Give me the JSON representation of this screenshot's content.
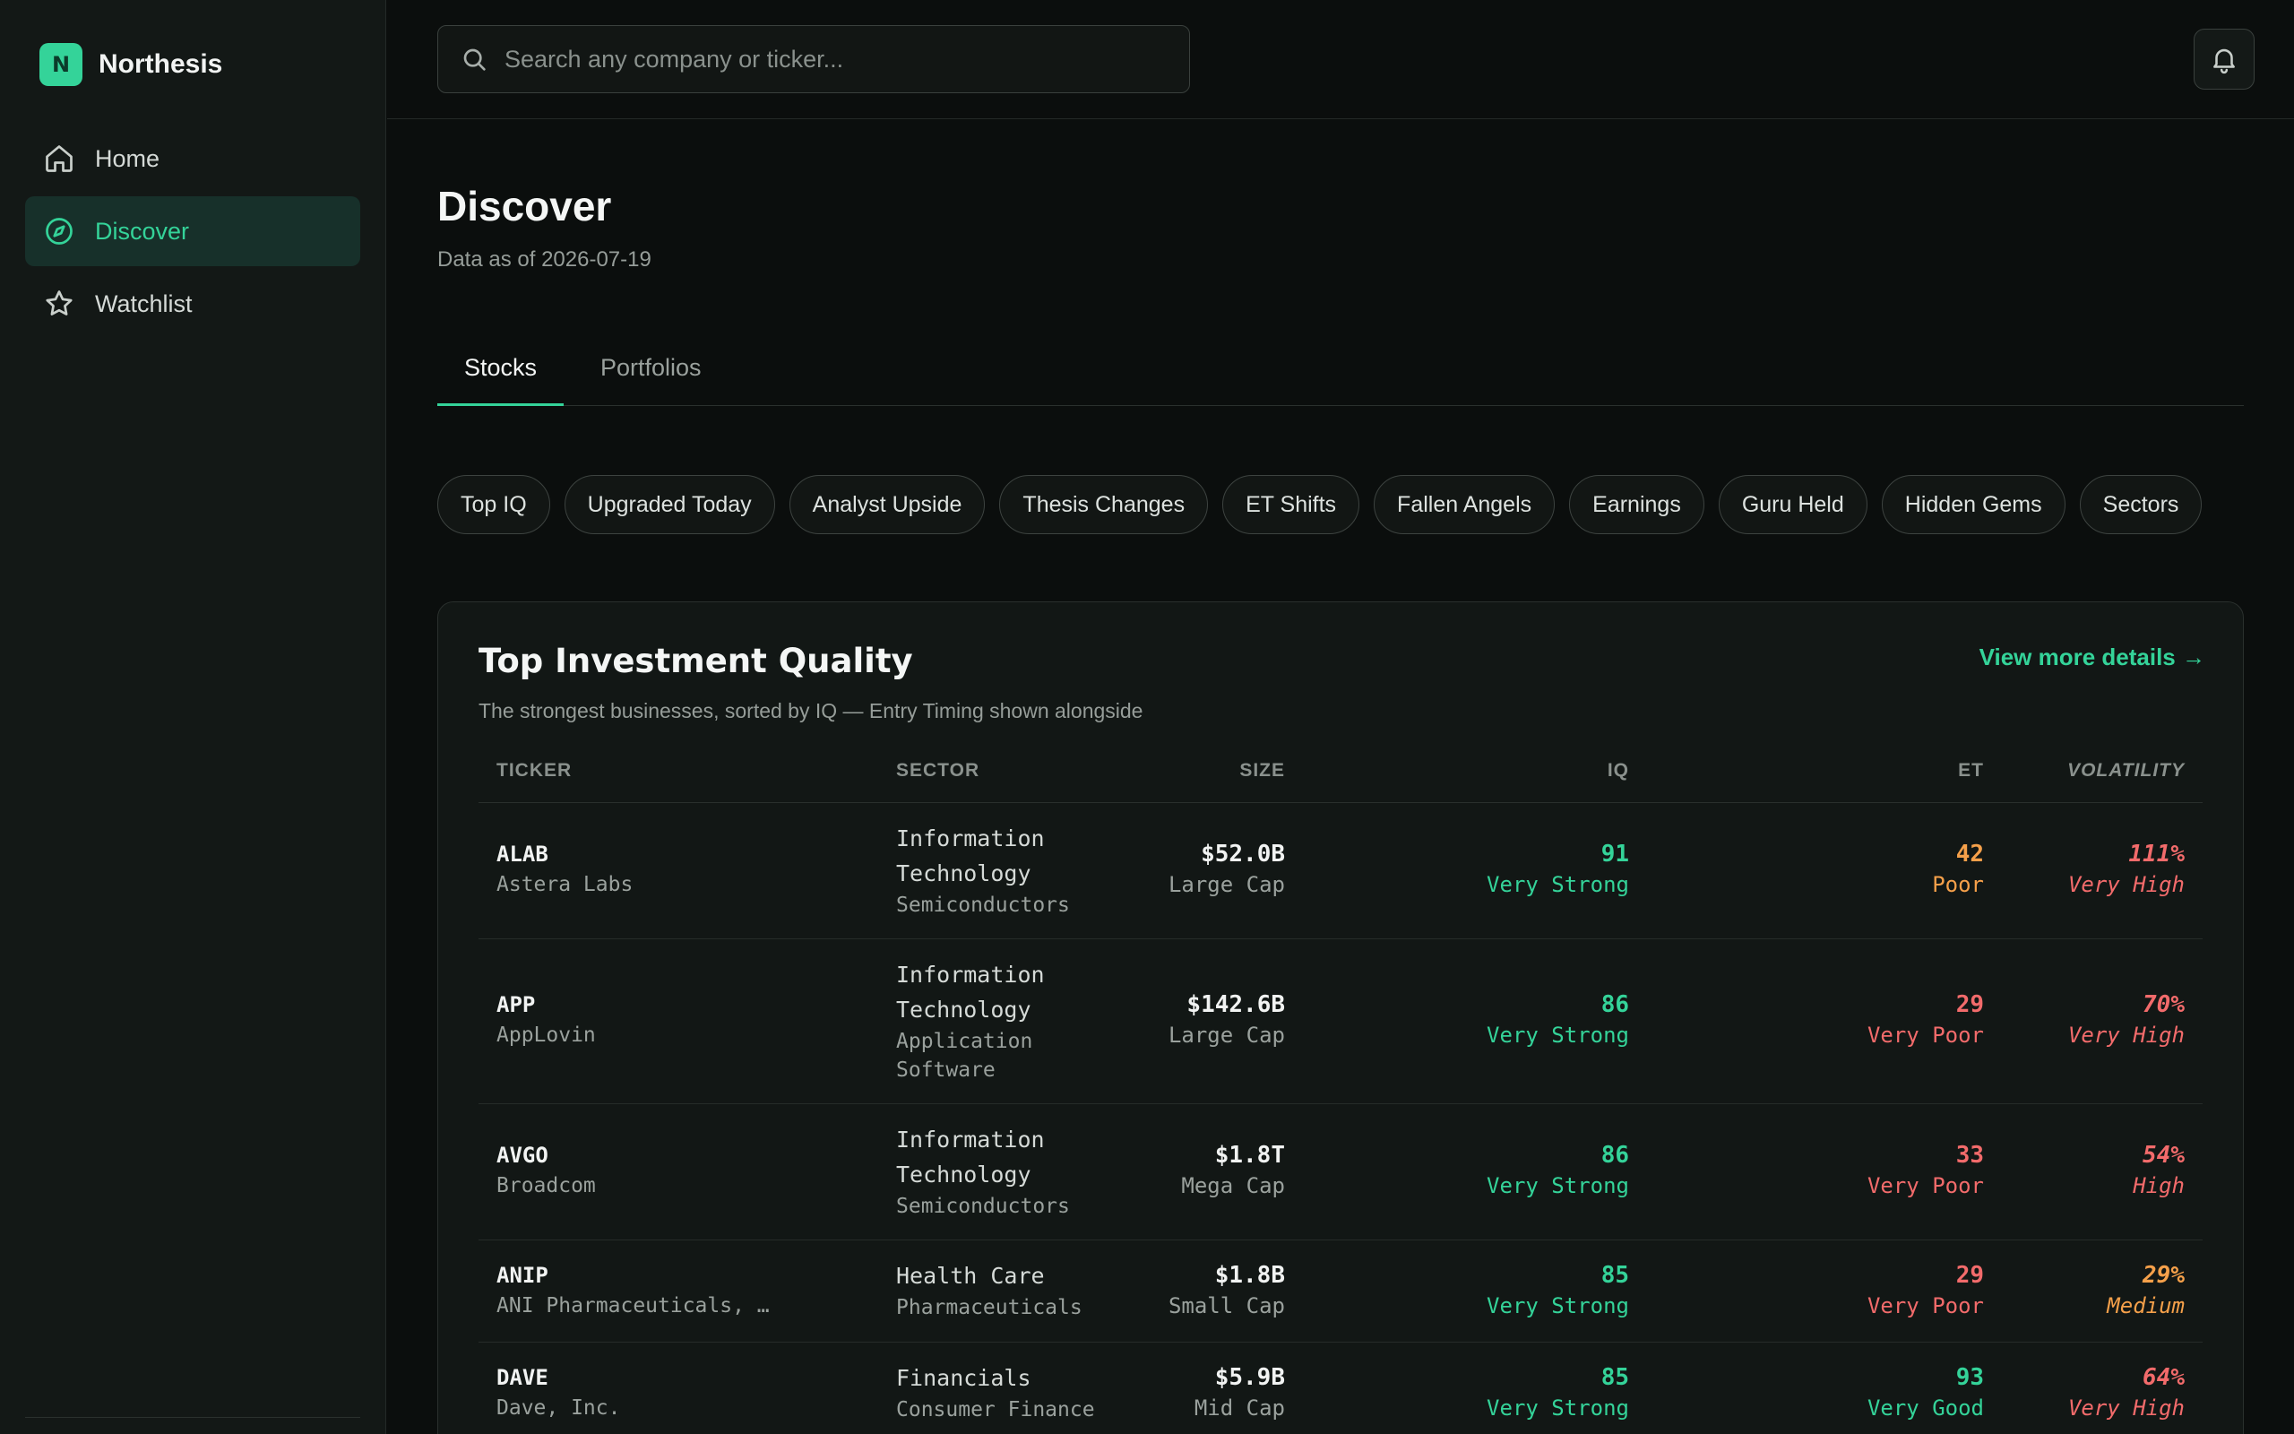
{
  "brand": {
    "logo_letter": "N",
    "name": "Northesis"
  },
  "nav": {
    "items": [
      {
        "label": "Home",
        "icon": "home-icon"
      },
      {
        "label": "Discover",
        "icon": "compass-icon",
        "active": true
      },
      {
        "label": "Watchlist",
        "icon": "star-icon"
      }
    ]
  },
  "search": {
    "placeholder": "Search any company or ticker..."
  },
  "page": {
    "title": "Discover",
    "subtitle": "Data as of 2026-07-19"
  },
  "tabs": [
    {
      "label": "Stocks",
      "active": true
    },
    {
      "label": "Portfolios"
    }
  ],
  "chips": [
    "Top IQ",
    "Upgraded Today",
    "Analyst Upside",
    "Thesis Changes",
    "ET Shifts",
    "Fallen Angels",
    "Earnings",
    "Guru Held",
    "Hidden Gems",
    "Sectors"
  ],
  "card": {
    "title": "Top Investment Quality",
    "link": "View more details →",
    "description": "The strongest businesses, sorted by IQ — Entry Timing shown alongside"
  },
  "table": {
    "headers": {
      "ticker": "TICKER",
      "sector": "SECTOR",
      "size": "SIZE",
      "iq": "IQ",
      "et": "ET",
      "volatility": "VOLATILITY"
    },
    "rows": [
      {
        "ticker": "ALAB",
        "company": "Astera Labs",
        "sector_line1": "Information",
        "sector_line2": "Technology",
        "industry_line1": "Semiconductors",
        "industry_line2": "",
        "size": "$52.0B",
        "cap": "Large Cap",
        "iq": "91",
        "iq_label": "Very Strong",
        "et": "42",
        "et_label": "Poor",
        "vol": "111%",
        "vol_label": "Very High"
      },
      {
        "ticker": "APP",
        "company": "AppLovin",
        "sector_line1": "Information",
        "sector_line2": "Technology",
        "industry_line1": "Application",
        "industry_line2": "Software",
        "size": "$142.6B",
        "cap": "Large Cap",
        "iq": "86",
        "iq_label": "Very Strong",
        "et": "29",
        "et_label": "Very Poor",
        "vol": "70%",
        "vol_label": "Very High"
      },
      {
        "ticker": "AVGO",
        "company": "Broadcom",
        "sector_line1": "Information",
        "sector_line2": "Technology",
        "industry_line1": "Semiconductors",
        "industry_line2": "",
        "size": "$1.8T",
        "cap": "Mega Cap",
        "iq": "86",
        "iq_label": "Very Strong",
        "et": "33",
        "et_label": "Very Poor",
        "vol": "54%",
        "vol_label": "High"
      },
      {
        "ticker": "ANIP",
        "company": "ANI Pharmaceuticals, …",
        "sector_line1": "Health Care",
        "sector_line2": "",
        "industry_line1": "Pharmaceuticals",
        "industry_line2": "",
        "size": "$1.8B",
        "cap": "Small Cap",
        "iq": "85",
        "iq_label": "Very Strong",
        "et": "29",
        "et_label": "Very Poor",
        "vol": "29%",
        "vol_label": "Medium"
      },
      {
        "ticker": "DAVE",
        "company": "Dave, Inc.",
        "sector_line1": "Financials",
        "sector_line2": "",
        "industry_line1": "Consumer Finance",
        "industry_line2": "",
        "size": "$5.9B",
        "cap": "Mid Cap",
        "iq": "85",
        "iq_label": "Very Strong",
        "et": "93",
        "et_label": "Very Good",
        "vol": "64%",
        "vol_label": "Very High"
      }
    ]
  },
  "colors": {
    "accent": "#34d399",
    "poor": "#f5a04a",
    "very_poor": "#f26b6b",
    "medium": "#f5a04a"
  }
}
